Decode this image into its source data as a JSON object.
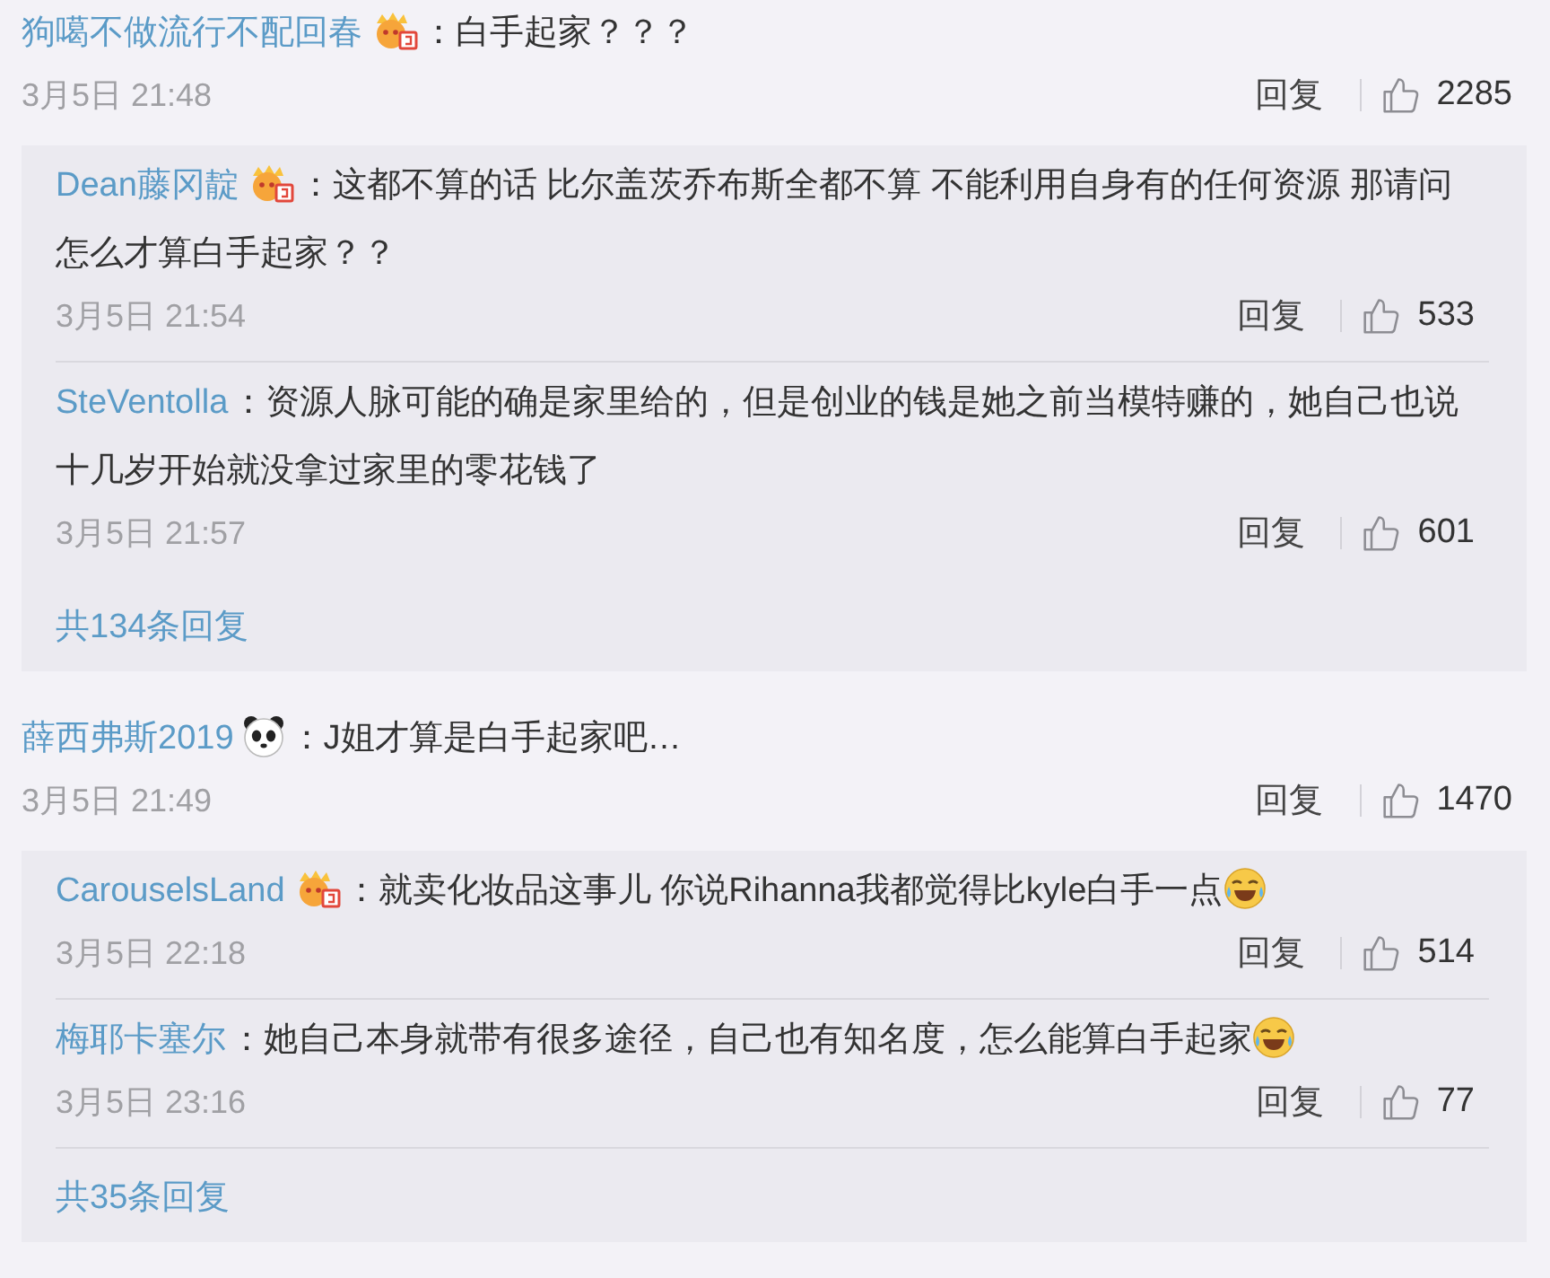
{
  "comments": [
    {
      "user": "狗噶不做流行不配回春",
      "badge": {
        "kind": "member"
      },
      "text": "：白手起家？？？",
      "emoji": false,
      "time": "3月5日 21:48",
      "reply_action": "回复",
      "likes": "2285",
      "replies": {
        "items": [
          {
            "user": "Dean藤冈靛",
            "badge": {
              "kind": "member"
            },
            "text": "：这都不算的话 比尔盖茨乔布斯全都不算 不能利用自身有的任何资源 那请问怎么才算白手起家？？",
            "emoji": false,
            "time": "3月5日 21:54",
            "reply_action": "回复",
            "likes": "533"
          },
          {
            "user": "SteVentolla",
            "text": "：资源人脉可能的确是家里给的，但是创业的钱是她之前当模特赚的，她自己也说十几岁开始就没拿过家里的零花钱了",
            "emoji": false,
            "time": "3月5日 21:57",
            "reply_action": "回复",
            "likes": "601"
          }
        ],
        "more": "共134条回复",
        "more_divider": false
      }
    },
    {
      "user": "薛西弗斯2019",
      "badge": {
        "kind": "panda"
      },
      "text": "：J姐才算是白手起家吧…",
      "emoji": false,
      "time": "3月5日 21:49",
      "reply_action": "回复",
      "likes": "1470",
      "replies": {
        "items": [
          {
            "user": "CarouselsLand",
            "badge": {
              "kind": "member"
            },
            "text": "：就卖化妆品这事儿 你说Rihanna我都觉得比kyle白手一点",
            "emoji": true,
            "time": "3月5日 22:18",
            "reply_action": "回复",
            "likes": "514"
          },
          {
            "user": "梅耶卡塞尔",
            "text": "：她自己本身就带有很多途径，自己也有知名度，怎么能算白手起家",
            "emoji": true,
            "time": "3月5日 23:16",
            "reply_action": "回复",
            "likes": "77"
          }
        ],
        "more": "共35条回复",
        "more_divider": true
      }
    }
  ]
}
